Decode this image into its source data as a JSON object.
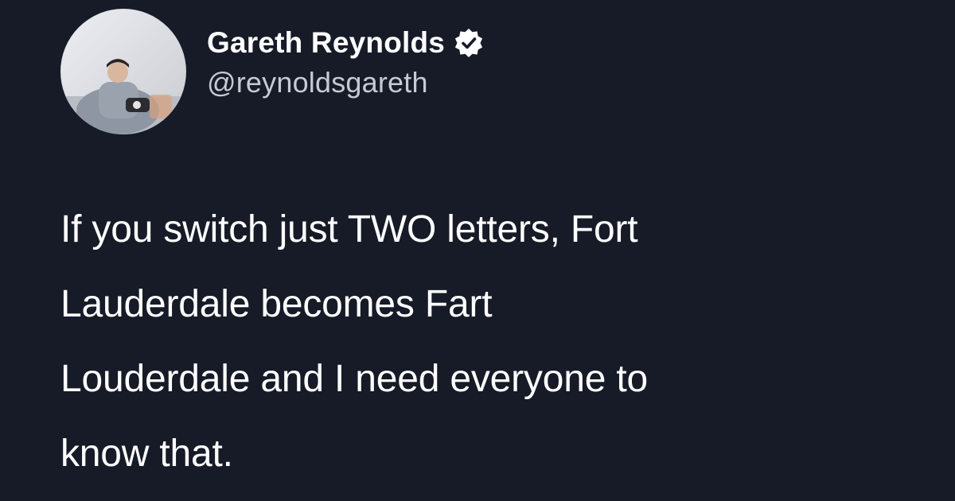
{
  "author": {
    "display_name": "Gareth Reynolds",
    "handle": "@reynoldsgareth",
    "verified": true,
    "avatar_icon": "profile-photo-avatar"
  },
  "tweet": {
    "lines": [
      "If you switch just TWO letters, Fort",
      "Lauderdale becomes Fart",
      "Louderdale and I need everyone to",
      "know that."
    ]
  },
  "colors": {
    "background": "#161b27",
    "text_primary": "#ffffff",
    "text_secondary": "#c5cad3",
    "verified_badge": "#ffffff"
  }
}
